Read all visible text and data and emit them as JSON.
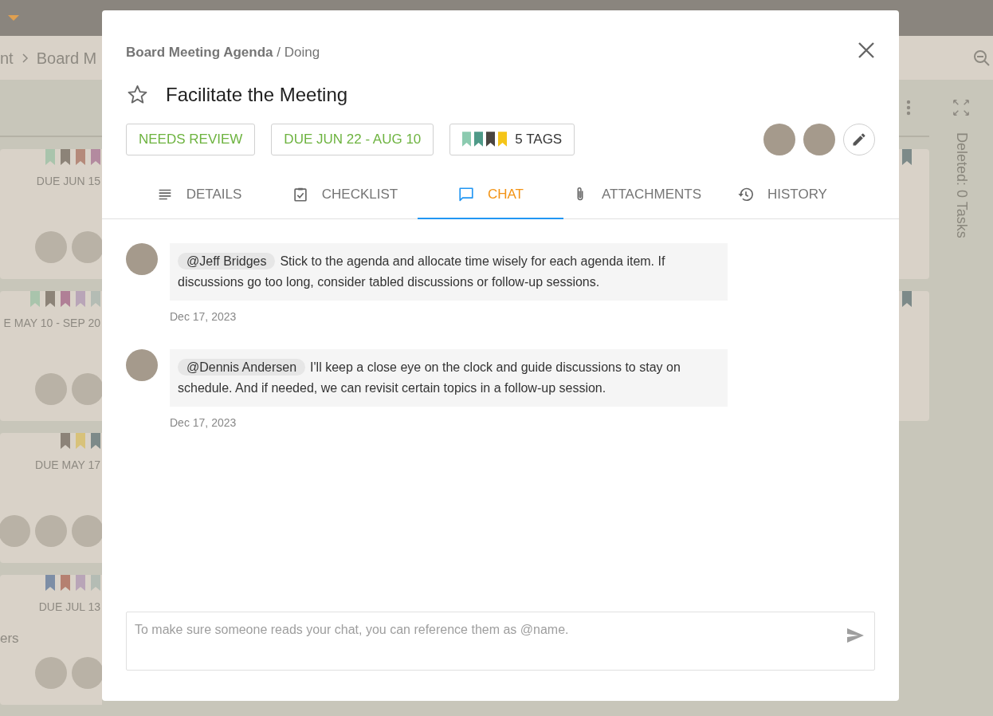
{
  "background": {
    "breadcrumb": [
      "nt",
      "Board M"
    ],
    "left_cards": [
      {
        "tags": [
          {
            "color": "#a9c4ac"
          },
          {
            "color": "#8c8378"
          },
          {
            "color": "#b58a7a"
          },
          {
            "color": "#b38a9f"
          }
        ],
        "due": "DUE JUN 15",
        "avatars": [
          {
            "kind": "photo"
          },
          {
            "kind": "photo"
          }
        ]
      },
      {
        "tags": [
          {
            "color": "#a9c4ac"
          },
          {
            "color": "#8c8378"
          },
          {
            "color": "#b07f96"
          },
          {
            "color": "#b9a5b8"
          },
          {
            "color": "#b4bcb4"
          }
        ],
        "due": "E MAY 10 - SEP 20",
        "avatars": [
          {
            "kind": "photo"
          },
          {
            "kind": "photo"
          }
        ]
      },
      {
        "tags": [
          {
            "color": "#8c8378"
          },
          {
            "color": "#d8c27a"
          },
          {
            "color": "#7d8a89"
          }
        ],
        "due": "DUE MAY 17",
        "avatars": [
          {
            "kind": "photo"
          },
          {
            "kind": "photo"
          },
          {
            "kind": "photo"
          }
        ]
      },
      {
        "tags": [
          {
            "color": "#7d8ea6"
          },
          {
            "color": "#b58070"
          },
          {
            "color": "#b9a5b8"
          },
          {
            "color": "#b4bcb4"
          }
        ],
        "due": "DUE JUL 13",
        "title": "ers",
        "avatars": [
          {
            "kind": "photo"
          },
          {
            "kind": "photo"
          }
        ]
      }
    ],
    "right_cards": [
      {
        "tags": [
          {
            "color": "#7d8a89"
          }
        ]
      },
      {
        "tags": [
          {
            "color": "#7d8a89"
          }
        ]
      }
    ],
    "deleted_label": "Deleted: 0 Tasks"
  },
  "dialog": {
    "breadcrumb": {
      "board": "Board Meeting Agenda",
      "list": "/ Doing"
    },
    "starred": false,
    "title": "Facilitate the Meeting",
    "chips": [
      {
        "kind": "status",
        "label": "NEEDS REVIEW"
      },
      {
        "kind": "due",
        "label": "DUE JUN 22 - AUG 10"
      },
      {
        "kind": "tags",
        "label": "5 TAGS",
        "tags": [
          {
            "color": "#8ccbb0"
          },
          {
            "color": "#4e9a88"
          },
          {
            "color": "#4a4540"
          },
          {
            "color": "#f5c518"
          }
        ]
      }
    ],
    "assignees": [
      {
        "kind": "photo"
      },
      {
        "kind": "photo"
      }
    ],
    "tabs": [
      {
        "kind": "details",
        "label": "DETAILS",
        "selected": false
      },
      {
        "kind": "checklist",
        "label": "CHECKLIST",
        "selected": false
      },
      {
        "kind": "chat",
        "label": "CHAT",
        "selected": true
      },
      {
        "kind": "attachments",
        "label": "ATTACHMENTS",
        "selected": false
      },
      {
        "kind": "history",
        "label": "HISTORY",
        "selected": false
      }
    ],
    "messages": [
      {
        "mention": "@Jeff Bridges",
        "text": "Stick to the agenda and allocate time wisely for each agenda item. If discussions go too long, consider tabled discussions or follow-up sessions.",
        "date": "Dec 17, 2023"
      },
      {
        "mention": "@Dennis Andersen",
        "text": "I'll keep a close eye on the clock and guide discussions to stay on schedule. And if needed, we can revisit certain topics in a follow-up session.",
        "date": "Dec 17, 2023"
      }
    ],
    "composer": {
      "placeholder": "To make sure someone reads your chat, you can reference them as @name."
    }
  }
}
